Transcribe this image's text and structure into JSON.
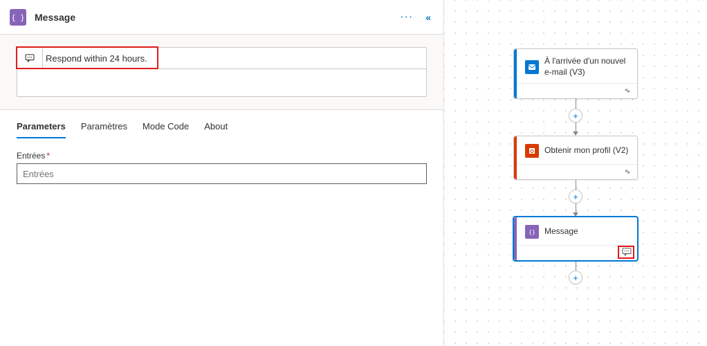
{
  "panel": {
    "title": "Message",
    "note_text": "Respond within 24 hours.",
    "tabs": [
      "Parameters",
      "Paramètres",
      "Mode Code",
      "About"
    ],
    "active_tab_index": 0,
    "field_label": "Entrées",
    "field_placeholder": "Entrées"
  },
  "flow": {
    "cards": [
      {
        "title": "À l'arrivée d'un nouvel e-mail (V3)",
        "accent": "#0078d4",
        "icon": "outlook"
      },
      {
        "title": "Obtenir mon profil (V2)",
        "accent": "#d83b01",
        "icon": "office"
      },
      {
        "title": "Message",
        "accent": "#8764B8",
        "icon": "code",
        "selected": true,
        "hasNote": true
      }
    ]
  },
  "icons": {
    "chat": "chat-icon",
    "link": "link-icon",
    "plus": "+"
  }
}
